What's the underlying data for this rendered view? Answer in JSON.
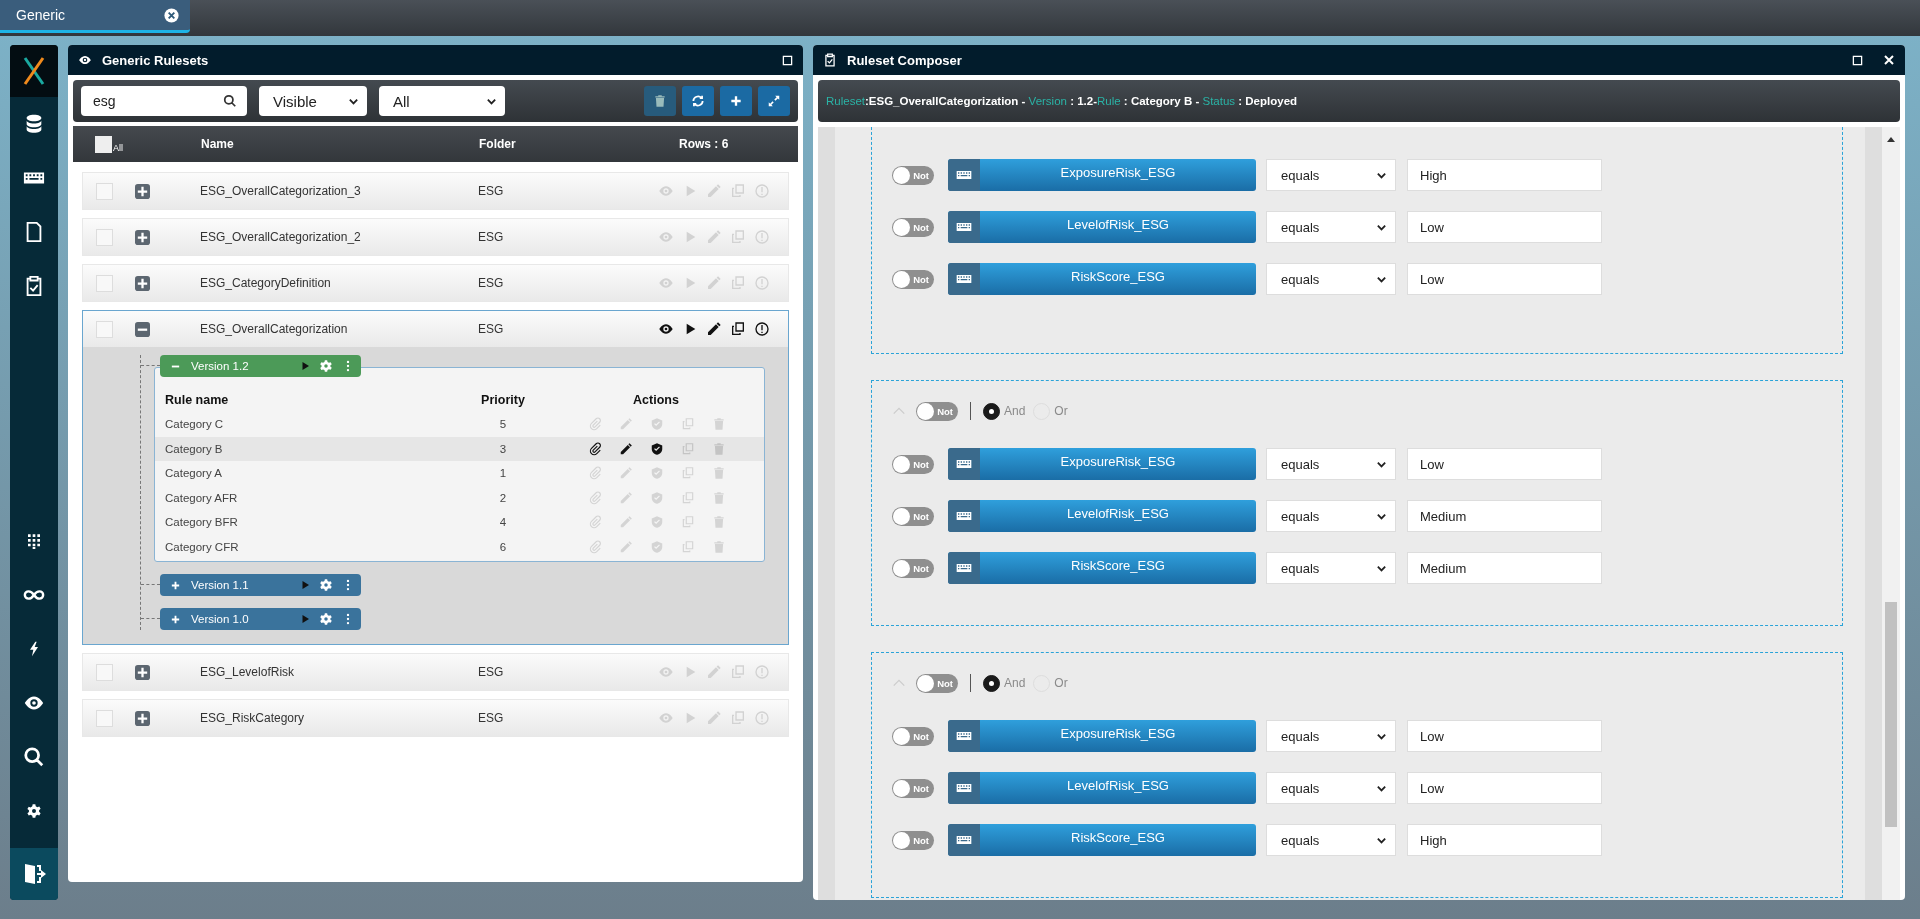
{
  "tab": {
    "label": "Generic"
  },
  "rulesets_panel": {
    "title": "Generic Rulesets",
    "search": {
      "value": "esg"
    },
    "visibility_filter": {
      "value": "Visible"
    },
    "folder_filter": {
      "value": "All"
    },
    "table": {
      "select_all_label": "All",
      "select_all_checked": false,
      "columns": [
        "Name",
        "Folder"
      ],
      "rows_count": "Rows : 6",
      "rows": [
        {
          "name": "ESG_OverallCategorization_3",
          "folder": "ESG",
          "checked": false,
          "expanded": false
        },
        {
          "name": "ESG_OverallCategorization_2",
          "folder": "ESG",
          "checked": false,
          "expanded": false
        },
        {
          "name": "ESG_CategoryDefinition",
          "folder": "ESG",
          "checked": false,
          "expanded": false
        },
        {
          "name": "ESG_OverallCategorization",
          "folder": "ESG",
          "checked": false,
          "expanded": true,
          "versions": [
            {
              "label": "Version 1.2",
              "expanded": true,
              "rules": {
                "columns": [
                  "Rule name",
                  "Priority",
                  "Actions"
                ],
                "rows": [
                  {
                    "name": "Category C",
                    "priority": "5",
                    "selected": false
                  },
                  {
                    "name": "Category B",
                    "priority": "3",
                    "selected": true
                  },
                  {
                    "name": "Category A",
                    "priority": "1",
                    "selected": false
                  },
                  {
                    "name": "Category AFR",
                    "priority": "2",
                    "selected": false
                  },
                  {
                    "name": "Category BFR",
                    "priority": "4",
                    "selected": false
                  },
                  {
                    "name": "Category CFR",
                    "priority": "6",
                    "selected": false
                  }
                ]
              }
            },
            {
              "label": "Version 1.1",
              "expanded": false
            },
            {
              "label": "Version 1.0",
              "expanded": false
            }
          ]
        },
        {
          "name": "ESG_LevelofRisk",
          "folder": "ESG",
          "checked": false,
          "expanded": false
        },
        {
          "name": "ESG_RiskCategory",
          "folder": "ESG",
          "checked": false,
          "expanded": false
        }
      ]
    }
  },
  "composer": {
    "title": "Ruleset Composer",
    "info": [
      {
        "kind": "label",
        "text": "Ruleset"
      },
      {
        "kind": "value",
        "text": ":ESG_OverallCategorization - "
      },
      {
        "kind": "label",
        "text": "Version"
      },
      {
        "kind": "value",
        "text": " : 1.2-"
      },
      {
        "kind": "label",
        "text": "Rule"
      },
      {
        "kind": "value",
        "text": " : Category B - "
      },
      {
        "kind": "label",
        "text": "Status"
      },
      {
        "kind": "value",
        "text": " : Deployed"
      }
    ],
    "groups": [
      {
        "conditions": [
          {
            "not_label": "Not",
            "not": false,
            "field": "ExposureRisk_ESG",
            "operator": "equals",
            "value": "High"
          },
          {
            "not_label": "Not",
            "not": false,
            "field": "LevelofRisk_ESG",
            "operator": "equals",
            "value": "Low"
          },
          {
            "not_label": "Not",
            "not": false,
            "field": "RiskScore_ESG",
            "operator": "equals",
            "value": "Low"
          }
        ]
      },
      {
        "header": {
          "not_label": "Not",
          "not": false,
          "logic": [
            {
              "label": "And",
              "selected": true
            },
            {
              "label": "Or",
              "selected": false
            }
          ]
        },
        "conditions": [
          {
            "not_label": "Not",
            "not": false,
            "field": "ExposureRisk_ESG",
            "operator": "equals",
            "value": "Low"
          },
          {
            "not_label": "Not",
            "not": false,
            "field": "LevelofRisk_ESG",
            "operator": "equals",
            "value": "Medium"
          },
          {
            "not_label": "Not",
            "not": false,
            "field": "RiskScore_ESG",
            "operator": "equals",
            "value": "Medium"
          }
        ]
      },
      {
        "header": {
          "not_label": "Not",
          "not": false,
          "logic": [
            {
              "label": "And",
              "selected": true
            },
            {
              "label": "Or",
              "selected": false
            }
          ]
        },
        "conditions": [
          {
            "not_label": "Not",
            "not": false,
            "field": "ExposureRisk_ESG",
            "operator": "equals",
            "value": "Low"
          },
          {
            "not_label": "Not",
            "not": false,
            "field": "LevelofRisk_ESG",
            "operator": "equals",
            "value": "Low"
          },
          {
            "not_label": "Not",
            "not": false,
            "field": "RiskScore_ESG",
            "operator": "equals",
            "value": "High"
          }
        ]
      }
    ]
  }
}
